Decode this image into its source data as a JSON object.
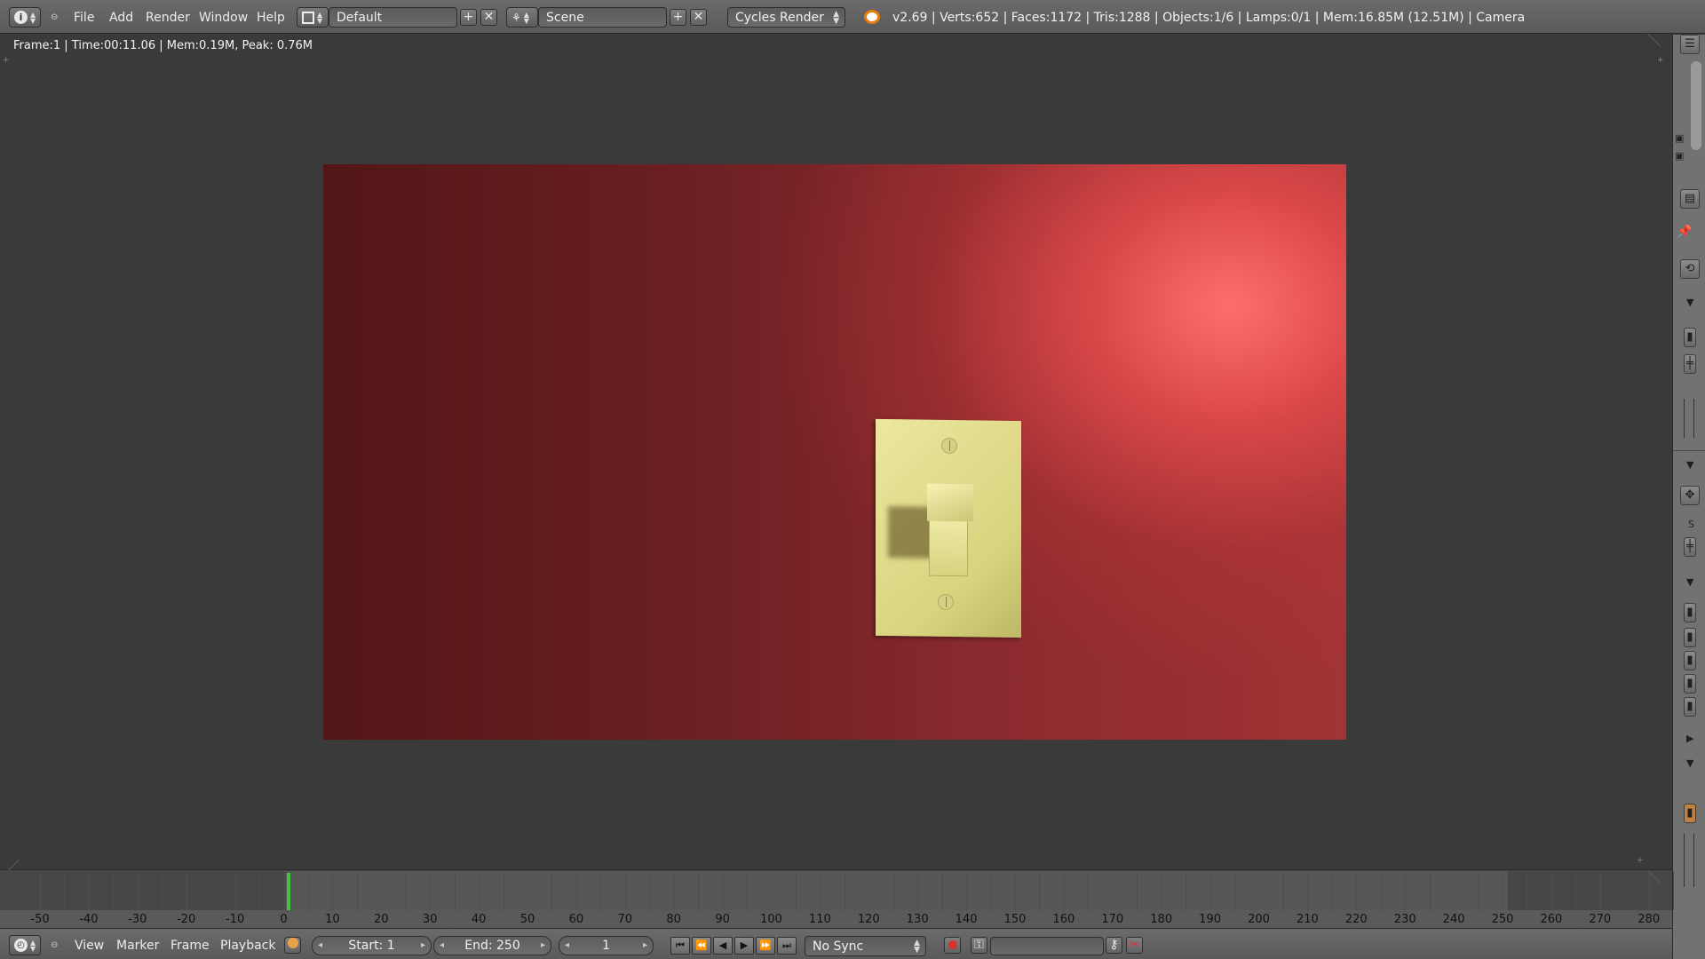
{
  "top_bar": {
    "menus": [
      "File",
      "Add",
      "Render",
      "Window",
      "Help"
    ],
    "screen_layout": "Default",
    "scene": "Scene",
    "render_engine": "Cycles Render",
    "stats": "v2.69 | Verts:652 | Faces:1172 | Tris:1288 | Objects:1/6 | Lamps:0/1 | Mem:16.85M (12.51M) | Camera"
  },
  "viewport": {
    "render_info": "Frame:1 | Time:00:11.06 | Mem:0.19M, Peak: 0.76M"
  },
  "timeline": {
    "ticks": [
      "-50",
      "-40",
      "-30",
      "-20",
      "-10",
      "0",
      "10",
      "20",
      "30",
      "40",
      "50",
      "60",
      "70",
      "80",
      "90",
      "100",
      "110",
      "120",
      "130",
      "140",
      "150",
      "160",
      "170",
      "180",
      "190",
      "200",
      "210",
      "220",
      "230",
      "240",
      "250",
      "260",
      "270",
      "280"
    ],
    "current_frame_marker": 1
  },
  "bottom_bar": {
    "menus": [
      "View",
      "Marker",
      "Frame",
      "Playback"
    ],
    "start": "Start: 1",
    "end": "End: 250",
    "current_frame": "1",
    "sync": "No Sync"
  },
  "colors": {
    "playhead": "#3fc43f",
    "record_button": "#d8342a"
  }
}
